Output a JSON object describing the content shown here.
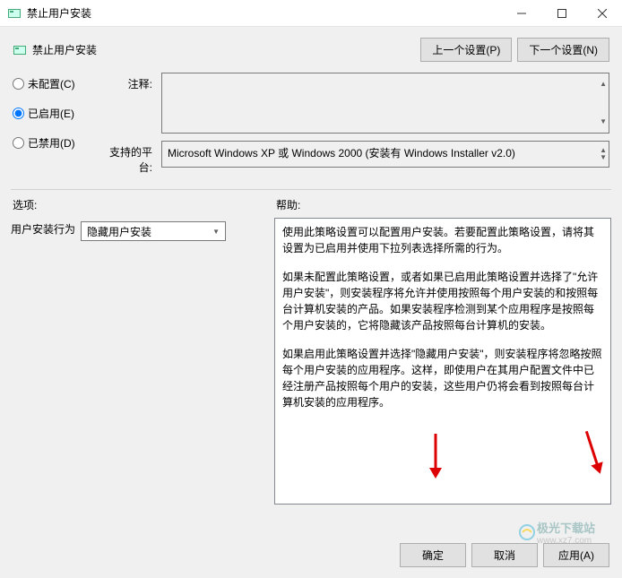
{
  "window": {
    "title": "禁止用户安装"
  },
  "header": {
    "title": "禁止用户安装",
    "prev": "上一个设置(P)",
    "next": "下一个设置(N)"
  },
  "radios": {
    "unconfigured": "未配置(C)",
    "enabled": "已启用(E)",
    "disabled": "已禁用(D)",
    "selected": "enabled"
  },
  "info": {
    "comment_label": "注释:",
    "comment_value": "",
    "platform_label": "支持的平台:",
    "platform_value": "Microsoft Windows XP 或 Windows 2000 (安装有 Windows Installer v2.0)"
  },
  "sections": {
    "options": "选项:",
    "help": "帮助:"
  },
  "options": {
    "behavior_label": "用户安装行为",
    "behavior_value": "隐藏用户安装"
  },
  "help": {
    "p1": "使用此策略设置可以配置用户安装。若要配置此策略设置，请将其设置为已启用并使用下拉列表选择所需的行为。",
    "p2": "如果未配置此策略设置，或者如果已启用此策略设置并选择了\"允许用户安装\"，则安装程序将允许并使用按照每个用户安装的和按照每台计算机安装的产品。如果安装程序检测到某个应用程序是按照每个用户安装的，它将隐藏该产品按照每台计算机的安装。",
    "p3": "如果启用此策略设置并选择\"隐藏用户安装\"，则安装程序将忽略按照每个用户安装的应用程序。这样，即使用户在其用户配置文件中已经注册产品按照每个用户的安装，这些用户仍将会看到按照每台计算机安装的应用程序。"
  },
  "footer": {
    "ok": "确定",
    "cancel": "取消",
    "apply": "应用(A)"
  },
  "watermark": {
    "name": "极光下载站",
    "url": "www.xz7.com"
  }
}
